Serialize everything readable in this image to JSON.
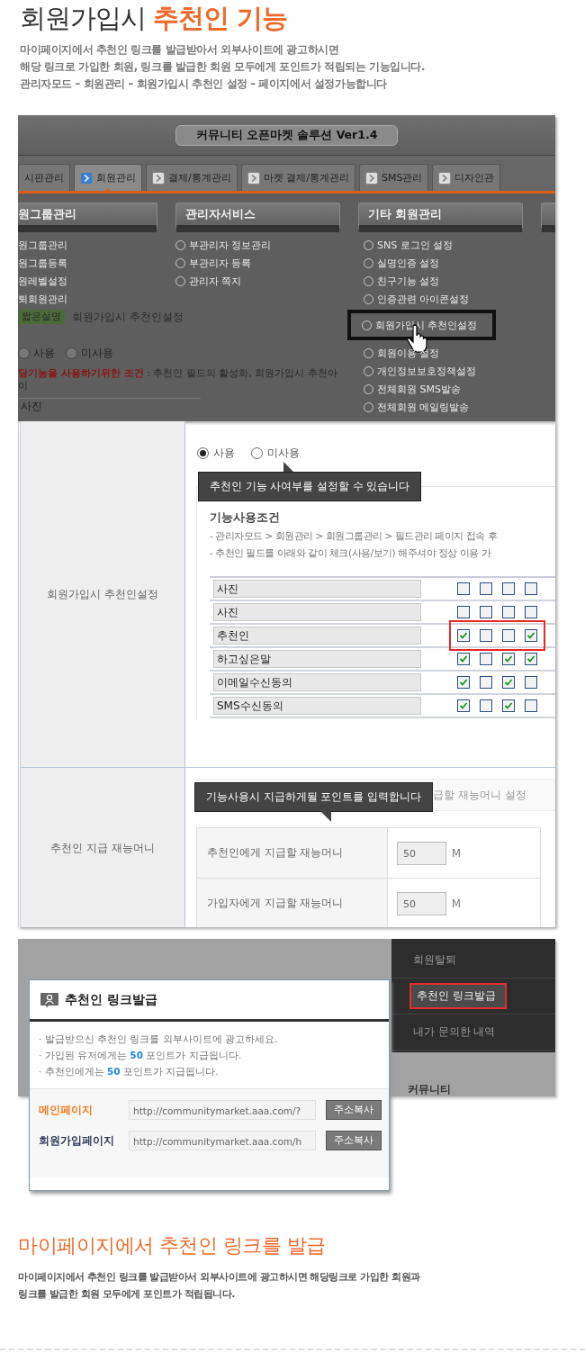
{
  "header": {
    "title": "회원가입시 **추천인 기능**",
    "intro": [
      "마이페이지에서 추천인 링크를 발급받아서 외부사이트에 광고하시면",
      "해당 링크로 가입한 회원, 링크를 발급한 회원 모두에게 포인트가 적립되는 기능입니다.",
      "관리자모드 – 회원관리 – 회원가입시 추천인 설정 – 페이지에서 설정가능합니다"
    ]
  },
  "admin_screen": {
    "window_title": "커뮤니티 오픈마켓 솔루션 Ver1.4",
    "tabs": [
      {
        "label": "시판관리",
        "selected": false
      },
      {
        "label": "회원관리",
        "selected": true
      },
      {
        "label": "결제/통계관리",
        "selected": false
      },
      {
        "label": "마켓 결제/통계관리",
        "selected": false
      },
      {
        "label": "SMS관리",
        "selected": false
      },
      {
        "label": "디자인관",
        "selected": false
      }
    ],
    "menu_columns": [
      {
        "title": "원그룹관리",
        "items": [
          {
            "label": "원그룹관리",
            "highlighted": false
          },
          {
            "label": "원그룹등록",
            "highlighted": false
          },
          {
            "label": "원레벨설정",
            "highlighted": false
          },
          {
            "label": "퇴회원관리",
            "highlighted": false
          }
        ]
      },
      {
        "title": "관리자서비스",
        "items": [
          {
            "label": "부관리자 정보관리",
            "highlighted": false
          },
          {
            "label": "부관리자 등록",
            "highlighted": false
          },
          {
            "label": "관리자 쪽지",
            "highlighted": false
          }
        ]
      },
      {
        "title": "기타 회원관리",
        "items": [
          {
            "label": "SNS 로그인 설정",
            "highlighted": false
          },
          {
            "label": "실명인증 설정",
            "highlighted": false
          },
          {
            "label": "친구기능 설정",
            "highlighted": false
          },
          {
            "label": "인증관련 아이콘설정",
            "highlighted": false
          },
          {
            "label": "회원가입시 추천인설정",
            "highlighted": true
          },
          {
            "label": "회원이용 설정",
            "highlighted": false
          },
          {
            "label": "개인정보보호정책설정",
            "highlighted": false
          },
          {
            "label": "전체회원 SMS발송",
            "highlighted": false
          },
          {
            "label": "전체회원 메일링발송",
            "highlighted": false
          }
        ]
      }
    ],
    "behind": {
      "badge": "짧은설명",
      "caption": "회원가입시 추천인설정",
      "options": [
        {
          "label": "사용",
          "selected": false
        },
        {
          "label": "미사용",
          "selected": false
        }
      ],
      "condition_label": "당기능을 사용하기위한 조건",
      "condition_text": ": 추천인 필드의 활성화, 회원가입시 추천아이",
      "field": "사진"
    }
  },
  "settings": [
    {
      "kind": "usage",
      "label": "회원가입시 추천인설정",
      "options": [
        {
          "label": "사용",
          "selected": true
        },
        {
          "label": "미사용",
          "selected": false
        }
      ],
      "tooltip": "추천인 기능 사여부를 설정할 수 있습니다",
      "conditions_title": "기능사용조건",
      "conditions": [
        "- 관리자모드 > 회원관리 > 회원그룹관리 > 필드관리 페이지 접속 후",
        "- 추천인 필드를 아래와 같이 체크(사용/보기) 해주셔야 정상 이용 가"
      ],
      "fields": [
        {
          "name": "사진",
          "checks": [
            false,
            false,
            false,
            false
          ],
          "highlighted": false
        },
        {
          "name": "사진",
          "checks": [
            false,
            false,
            false,
            false
          ],
          "highlighted": false
        },
        {
          "name": "추천인",
          "checks": [
            true,
            false,
            false,
            true
          ],
          "highlighted": true
        },
        {
          "name": "하고싶은말",
          "checks": [
            true,
            false,
            true,
            true
          ],
          "highlighted": false
        },
        {
          "name": "이메일수신동의",
          "checks": [
            true,
            false,
            true,
            false
          ],
          "highlighted": false
        },
        {
          "name": "SMS수신동의",
          "checks": [
            true,
            false,
            true,
            false
          ],
          "highlighted": false
        }
      ]
    },
    {
      "kind": "money",
      "label": "추천인 지급 재능머니",
      "tooltip": "기능사용시 지급하게될 포인트를 입력합니다",
      "heading": "급할 재능머니 설정",
      "rows": [
        {
          "label": "추천인에게 지급할 재능머니",
          "value": "50",
          "unit": "M"
        },
        {
          "label": "가입자에게 지급할 재능머니",
          "value": "50",
          "unit": "M"
        }
      ]
    }
  ],
  "mypage": {
    "menu": [
      {
        "label": "회원탈퇴",
        "highlighted": false
      },
      {
        "label": "추천인 링크발급",
        "highlighted": true
      },
      {
        "label": "내가 문의한 내역",
        "highlighted": false
      }
    ],
    "section": "커뮤니티",
    "popup": {
      "title": "추천인 링크발급",
      "notes": [
        "· 발급받으신 추천인 링크를 외부사이트에 광고하세요.",
        "· 가입된 유저에게는 **50** 포인트가 지급됩니다.",
        "· 추천인에게는 **50** 포인트가 지급됩니다."
      ],
      "links": [
        {
          "label": "메인페이지",
          "color": "#f47a20",
          "url": "http://communitymarket.aaa.com/?",
          "button": "주소복사"
        },
        {
          "label": "회원가입페이지",
          "color": "#2e3a55",
          "url": "http://communitymarket.aaa.com/h",
          "button": "주소복사"
        }
      ]
    }
  },
  "footer": {
    "heading": "마이페이지에서 추천인 링크를 발급",
    "lines": [
      "마이페이지에서 추천인 링크를 발급받아서 외부사이트에 광고하시면 해당링크로 가입한 회원과",
      "링크를 발급한 회원 모두에게 포인트가 적립됩니다."
    ]
  }
}
